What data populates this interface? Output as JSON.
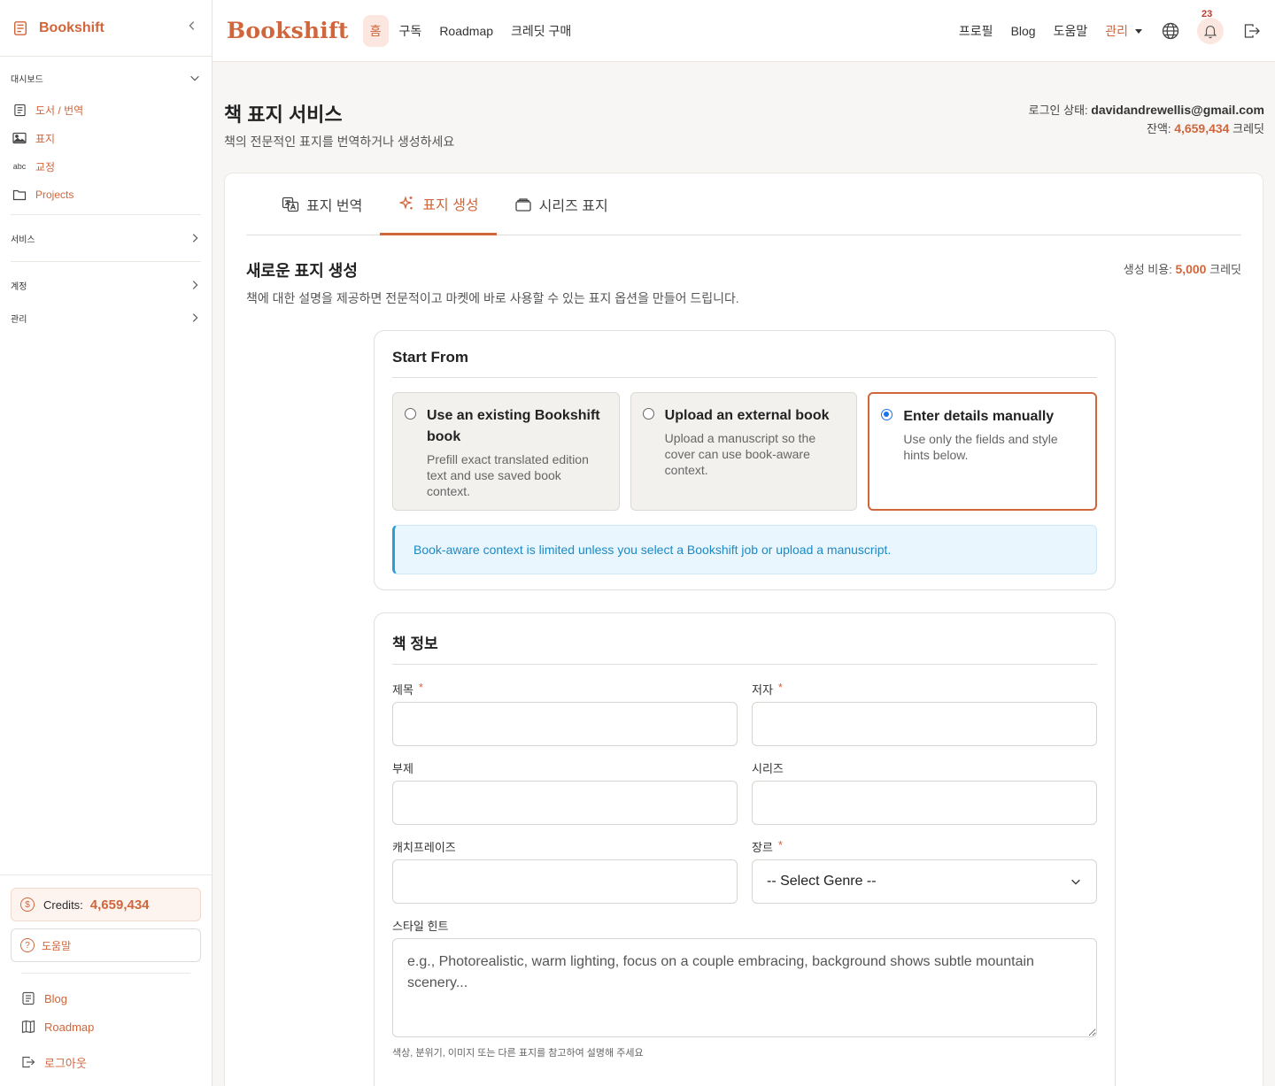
{
  "sidebar": {
    "brand": "Bookshift",
    "groups": {
      "dashboard": "대시보드",
      "services": "서비스",
      "account": "계정",
      "admin": "관리"
    },
    "items": [
      {
        "label": "도서 / 번역",
        "icon": "book-list-icon"
      },
      {
        "label": "표지",
        "icon": "image-icon"
      },
      {
        "label": "교정",
        "icon": "spellcheck-icon"
      },
      {
        "label": "Projects",
        "icon": "folder-icon"
      }
    ],
    "credits_label": "Credits:",
    "credits_value": "4,659,434",
    "help_label": "도움말",
    "links": [
      {
        "label": "Blog",
        "icon": "blog-icon"
      },
      {
        "label": "Roadmap",
        "icon": "map-icon"
      },
      {
        "label": "로그아웃",
        "icon": "logout-icon"
      }
    ]
  },
  "topnav": {
    "brand": "Bookshift",
    "home": "홈",
    "subscribe": "구독",
    "roadmap": "Roadmap",
    "buy_credits": "크레딧 구매",
    "profile": "프로필",
    "blog": "Blog",
    "help": "도움말",
    "admin": "관리",
    "notifications_count": "23"
  },
  "page": {
    "title": "책 표지 서비스",
    "subtitle": "책의 전문적인 표지를 번역하거나 생성하세요",
    "login_label": "로그인 상태:",
    "login_email": "davidandrewellis@gmail.com",
    "balance_label": "잔액:",
    "balance_value": "4,659,434",
    "balance_unit": "크레딧"
  },
  "tabs": [
    {
      "label": "표지 번역"
    },
    {
      "label": "표지 생성"
    },
    {
      "label": "시리즈 표지"
    }
  ],
  "section": {
    "title": "새로운 표지 생성",
    "description": "책에 대한 설명을 제공하면 전문적이고 마켓에 바로 사용할 수 있는 표지 옵션을 만들어 드립니다.",
    "cost_label": "생성 비용:",
    "cost_value": "5,000",
    "cost_unit": "크레딧"
  },
  "start_from": {
    "title": "Start From",
    "options": [
      {
        "title": "Use an existing Bookshift book",
        "desc": "Prefill exact translated edition text and use saved book context."
      },
      {
        "title": "Upload an external book",
        "desc": "Upload a manuscript so the cover can use book-aware context."
      },
      {
        "title": "Enter details manually",
        "desc": "Use only the fields and style hints below."
      }
    ],
    "alert": "Book-aware context is limited unless you select a Bookshift job or upload a manuscript."
  },
  "book_info": {
    "title": "책 정보",
    "title_label": "제목",
    "author_label": "저자",
    "subtitle_label": "부제",
    "series_label": "시리즈",
    "catchphrase_label": "캐치프레이즈",
    "genre_label": "장르",
    "genre_selected": "-- Select Genre --",
    "style_label": "스타일 힌트",
    "style_placeholder": "e.g., Photorealistic, warm lighting, focus on a couple embracing, background shows subtle mountain scenery...",
    "style_hint": "색상, 분위기, 이미지 또는 다른 표지를 참고하여 설명해 주세요",
    "required_mark": "*"
  }
}
